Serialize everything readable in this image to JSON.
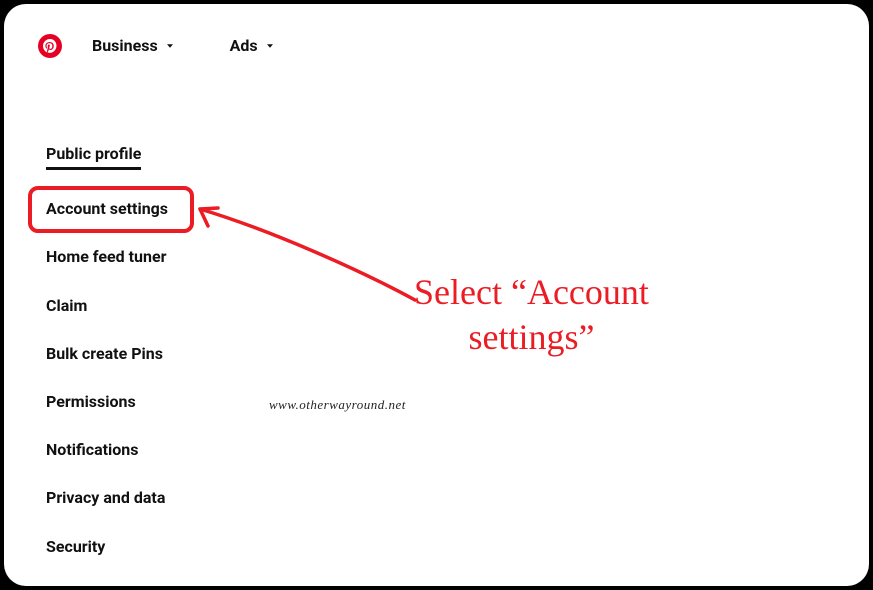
{
  "header": {
    "nav": [
      {
        "label": "Business"
      },
      {
        "label": "Ads"
      }
    ]
  },
  "sidebar": {
    "items": [
      {
        "label": "Public profile"
      },
      {
        "label": "Account settings"
      },
      {
        "label": "Home feed tuner"
      },
      {
        "label": "Claim"
      },
      {
        "label": "Bulk create Pins"
      },
      {
        "label": "Permissions"
      },
      {
        "label": "Notifications"
      },
      {
        "label": "Privacy and data"
      },
      {
        "label": "Security"
      }
    ],
    "active_index": 0,
    "highlighted_index": 1
  },
  "annotation": {
    "callout_line1": "Select “Account",
    "callout_line2": "settings”",
    "highlight_color": "#eb1c24"
  },
  "watermark": "www.otherwayround.net"
}
